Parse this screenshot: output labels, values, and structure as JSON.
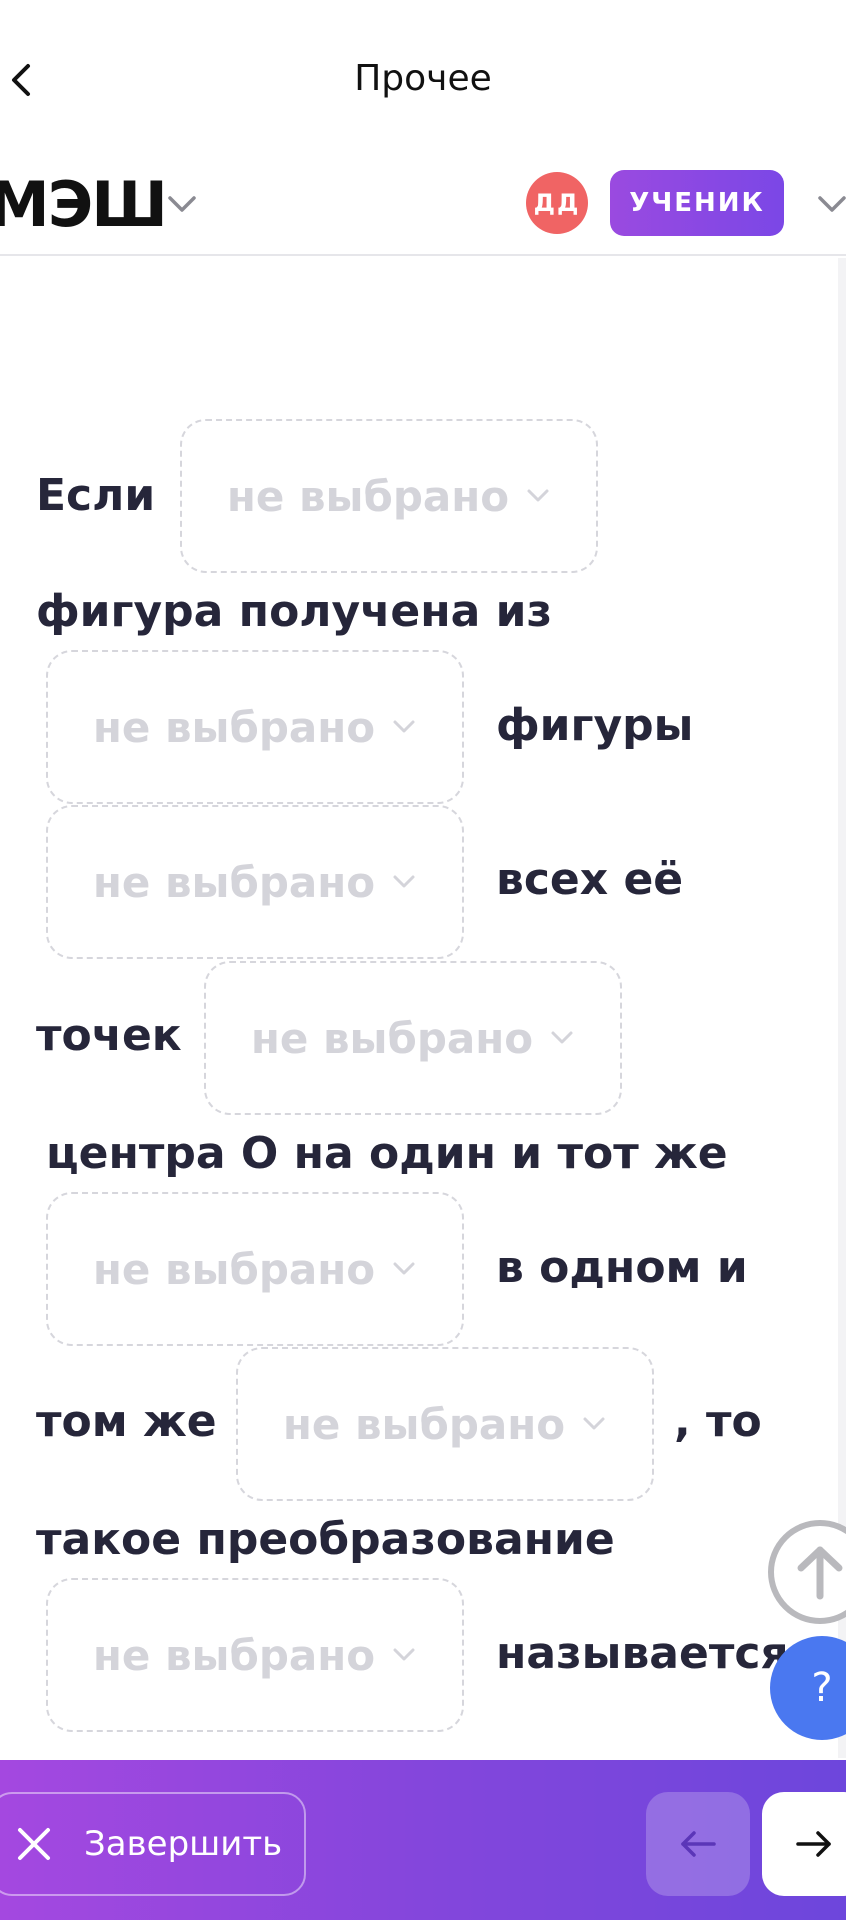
{
  "nav": {
    "title": "Прочее"
  },
  "header": {
    "logo": "МЭШ",
    "avatar_initials": "ДД",
    "role": "УЧЕНИК"
  },
  "question": {
    "words": [
      "Если",
      "фигура получена из",
      "фигуры",
      "всех её",
      "точек",
      "центра О на один и тот же",
      "в одном и",
      "том же",
      ", то",
      "такое преобразование",
      "называется"
    ],
    "dropdown_placeholder": "не выбрано"
  },
  "help": {
    "label": "?"
  },
  "footer": {
    "finish_label": "Завершить"
  },
  "colors": {
    "accent": "#7b47e6",
    "avatar": "#f06464",
    "help": "#4a78f0"
  }
}
